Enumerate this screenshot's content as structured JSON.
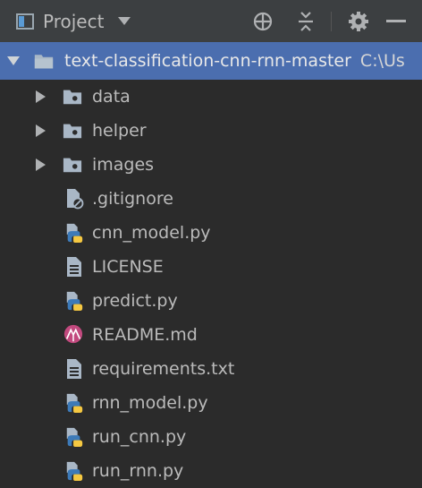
{
  "toolbar": {
    "title": "Project",
    "icons": [
      "project-view-icon",
      "chevron-down-icon",
      "locate-icon",
      "collapse-all-icon",
      "gear-icon",
      "minimize-icon"
    ]
  },
  "tree": {
    "root": {
      "name": "text-classification-cnn-rnn-master",
      "path": "C:\\Us",
      "expanded": true
    },
    "folders": [
      {
        "name": "data",
        "icon": "folder-icon"
      },
      {
        "name": "helper",
        "icon": "folder-icon"
      },
      {
        "name": "images",
        "icon": "folder-icon"
      }
    ],
    "files": [
      {
        "name": ".gitignore",
        "icon": "ignored-file-icon"
      },
      {
        "name": "cnn_model.py",
        "icon": "python-file-icon"
      },
      {
        "name": "LICENSE",
        "icon": "text-file-icon"
      },
      {
        "name": "predict.py",
        "icon": "python-file-icon"
      },
      {
        "name": "README.md",
        "icon": "markdown-file-icon"
      },
      {
        "name": "requirements.txt",
        "icon": "text-file-icon"
      },
      {
        "name": "rnn_model.py",
        "icon": "python-file-icon"
      },
      {
        "name": "run_cnn.py",
        "icon": "python-file-icon"
      },
      {
        "name": "run_rnn.py",
        "icon": "python-file-icon"
      }
    ]
  },
  "colors": {
    "background": "#2b2b2b",
    "toolbar": "#3c3f41",
    "selection": "#4b6eaf",
    "text": "#bbbbbb",
    "python_blue": "#3d7ab8",
    "python_yellow": "#f5c842",
    "markdown": "#c2497e"
  }
}
